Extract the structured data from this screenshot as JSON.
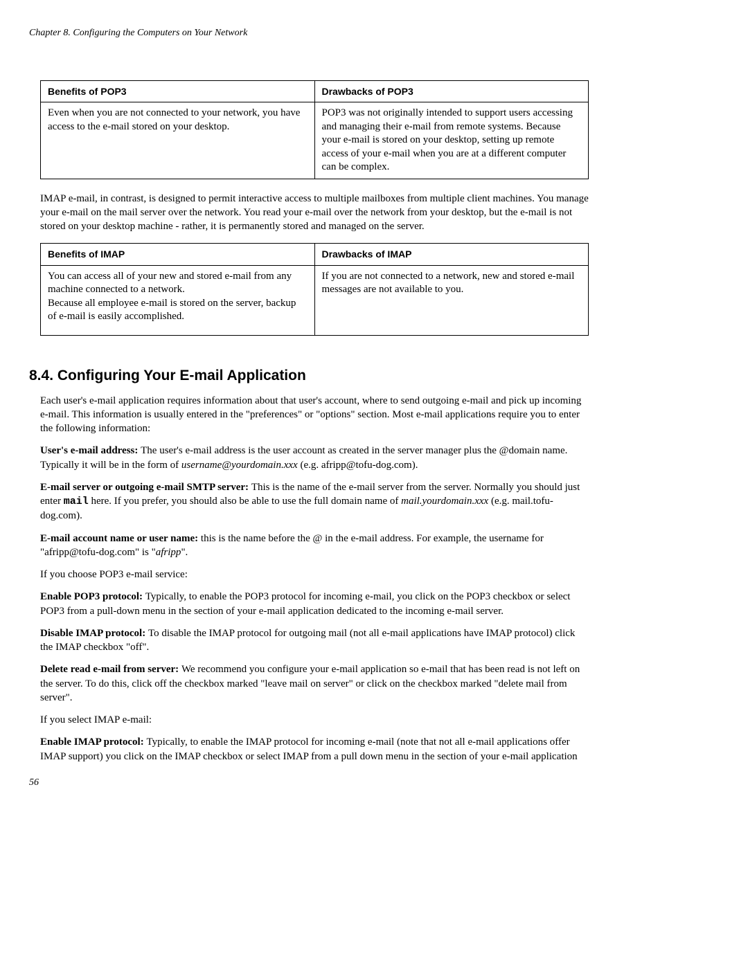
{
  "header": {
    "chapter": "Chapter 8. Configuring the Computers on Your Network"
  },
  "table_pop3": {
    "col1_header": "Benefits of POP3",
    "col2_header": "Drawbacks of POP3",
    "col1_body": "Even when you are not connected to your network, you have access to the e-mail stored on your desktop.",
    "col2_body": "POP3 was not originally intended to support users accessing and managing their e-mail from remote systems. Because your e-mail is stored on your desktop, setting up remote access of your e-mail when you are at a different computer can be complex."
  },
  "imap_intro": "IMAP e-mail, in contrast, is designed to permit interactive access to multiple mailboxes from multiple client machines. You manage your e-mail on the mail server over the network. You read your e-mail over the network from your desktop, but the e-mail is not stored on your desktop machine - rather, it is permanently stored and managed on the server.",
  "table_imap": {
    "col1_header": "Benefits of IMAP",
    "col2_header": "Drawbacks of IMAP",
    "col1_body_line1": "You can access all of your new and stored e-mail from any machine connected to a network.",
    "col1_body_line2": "Because all employee e-mail is stored on the server, backup of e-mail is easily accomplished.",
    "col2_body": "If you are not connected to a network, new and stored e-mail messages are not available to you."
  },
  "section": {
    "title": "8.4. Configuring Your E-mail Application",
    "intro": "Each user's e-mail application requires information about that user's account, where to send outgoing e-mail and pick up incoming e-mail. This information is usually entered in the \"preferences\" or \"options\" section. Most e-mail applications require you to enter the following information:",
    "email_addr_label": "User's e-mail address: ",
    "email_addr_text_a": "The user's e-mail address is the user account as created in the server manager plus the @domain name. Typically it will be in the form of ",
    "email_addr_ital": "username@yourdomain.xxx",
    "email_addr_text_b": " (e.g. afripp@tofu-dog.com).",
    "smtp_label": "E-mail server or outgoing e-mail SMTP server: ",
    "smtp_text_a": "This is the name of the e-mail server from the server. Normally you should just enter ",
    "smtp_mono": "mail",
    "smtp_text_b": " here. If you prefer, you should also be able to use the full domain name of ",
    "smtp_ital": "mail.yourdomain.xxx",
    "smtp_text_c": " (e.g. mail.tofu-dog.com).",
    "acct_label": "E-mail account name or user name: ",
    "acct_text_a": "this is the name before the @ in the e-mail address. For example, the username for \"afripp@tofu-dog.com\" is \"",
    "acct_ital": "afripp",
    "acct_text_b": "\".",
    "pop_choose": "If you choose POP3 e-mail service:",
    "enable_pop_label": "Enable POP3 protocol: ",
    "enable_pop_text": "Typically, to enable the POP3 protocol for incoming e-mail, you click on the POP3 checkbox or select POP3 from a pull-down menu in the section of your e-mail application dedicated to the incoming e-mail server.",
    "disable_imap_label": "Disable IMAP protocol: ",
    "disable_imap_text": "To disable the IMAP protocol for outgoing mail (not all e-mail applications have IMAP protocol) click the IMAP checkbox \"off\".",
    "delete_label": "Delete read e-mail from server: ",
    "delete_text": "We recommend you configure your e-mail application so e-mail that has been read is not left on the server. To do this, click off the checkbox marked \"leave mail on server\" or click on the checkbox marked \"delete mail from server\".",
    "imap_choose": "If you select IMAP e-mail:",
    "enable_imap_label": "Enable IMAP protocol: ",
    "enable_imap_text": "Typically, to enable the IMAP protocol for incoming e-mail (note that not all e-mail applications offer IMAP support) you click on the IMAP checkbox or select IMAP from a pull down menu in the section of your e-mail application"
  },
  "page_number": "56"
}
